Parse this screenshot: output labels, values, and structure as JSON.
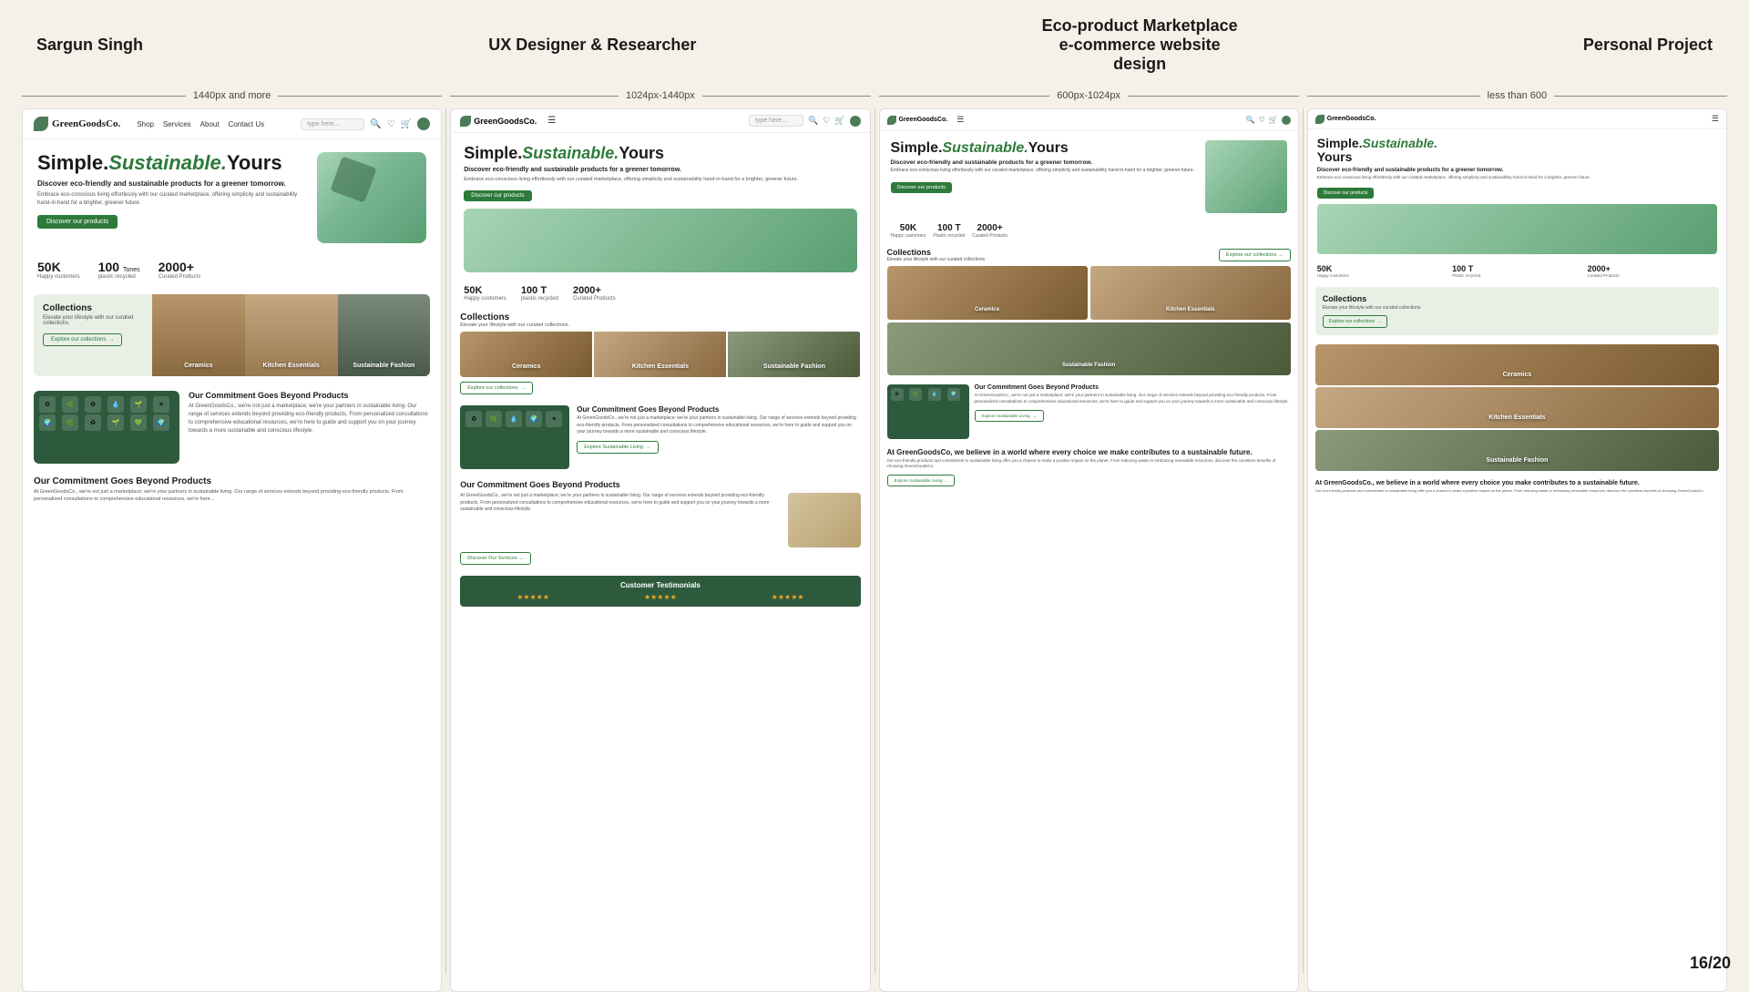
{
  "header": {
    "left": "Sargun Singh",
    "center": "UX Designer & Researcher",
    "project_line1": "Eco-product Marketplace",
    "project_line2": "e-commerce website",
    "project_line3": "design",
    "right": "Personal Project"
  },
  "breakpoints": {
    "bp1": "1440px and more",
    "bp2": "1024px-1440px",
    "bp3": "600px-1024px",
    "bp4": "less than 600"
  },
  "brand": {
    "name": "GreenGoodsCo.",
    "tagline_1": "Simple.",
    "tagline_2": "Sustainable.",
    "tagline_3": "Yours",
    "hero_sub": "Discover eco-friendly and sustainable products for a greener tomorrow.",
    "hero_desc": "Embrace eco-conscious living effortlessly with our curated marketplace, offering simplicity and sustainability hand-in-hand for a brighter, greener future.",
    "cta_btn": "Discover our products"
  },
  "stats": {
    "customers_num": "50K",
    "customers_label": "Happy customers",
    "plastic_num": "100 T",
    "plastic_label": "plastic recycled",
    "plastic_label2": "Tones",
    "products_num": "2000+",
    "products_label": "Curated Products"
  },
  "collections": {
    "title": "Collections",
    "subtitle": "Elevate your lifestyle with our curated collections.",
    "explore_btn": "Explore our collections",
    "items": [
      "Ceramics",
      "Kitchen Essentials",
      "Sustainable Fashion"
    ]
  },
  "eco": {
    "title": "Our Commitment Goes Beyond Products",
    "desc": "At GreenGoodsCo., we're not just a marketplace; we're your partners in sustainable living. Our range of services extends beyond providing eco-friendly products. From personalized consultations to comprehensive educational resources, we're here to guide and support you on your journey towards a more sustainable and conscious lifestyle.",
    "btn": "Explore Sustainable Living"
  },
  "nav": {
    "links": [
      "Shop",
      "Services",
      "About",
      "Contact Us"
    ],
    "search_placeholder": "type here..."
  },
  "testimonials": {
    "title": "Customer Testimonials"
  },
  "page_counter": "16/20"
}
